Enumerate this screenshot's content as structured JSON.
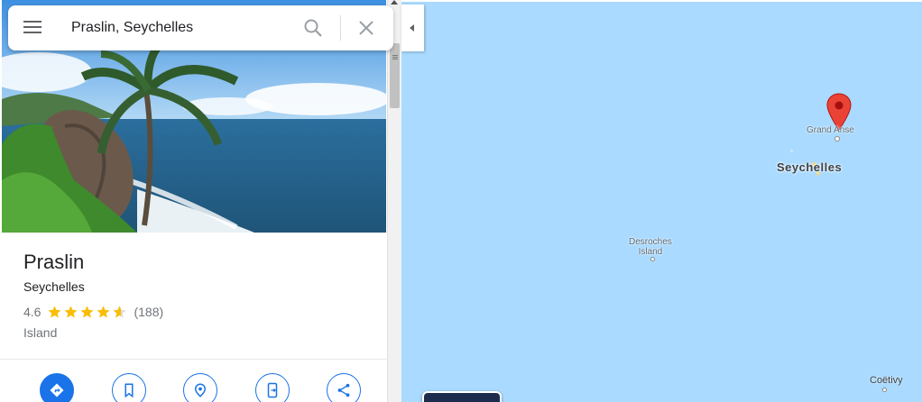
{
  "search": {
    "value": "Praslin, Seychelles"
  },
  "place": {
    "name": "Praslin",
    "region": "Seychelles",
    "rating": "4.6",
    "rating_fraction": 0.92,
    "review_count": "(188)",
    "category": "Island"
  },
  "actions": [
    {
      "name": "directions",
      "icon": "directions-icon"
    },
    {
      "name": "save",
      "icon": "bookmark-icon"
    },
    {
      "name": "nearby",
      "icon": "nearby-pin-icon"
    },
    {
      "name": "send-to-phone",
      "icon": "phone-send-icon"
    },
    {
      "name": "share",
      "icon": "share-icon"
    }
  ],
  "map": {
    "labels": {
      "grand_anse": "Grand Anse",
      "seychelles": "Seychelles",
      "desroches_line1": "Desroches",
      "desroches_line2": "Island"
    },
    "attribution": "Coëtivy",
    "colors": {
      "water": "#aadaff",
      "pin": "#ea4335",
      "accent": "#1a73e8",
      "star": "#fbbc04"
    }
  }
}
